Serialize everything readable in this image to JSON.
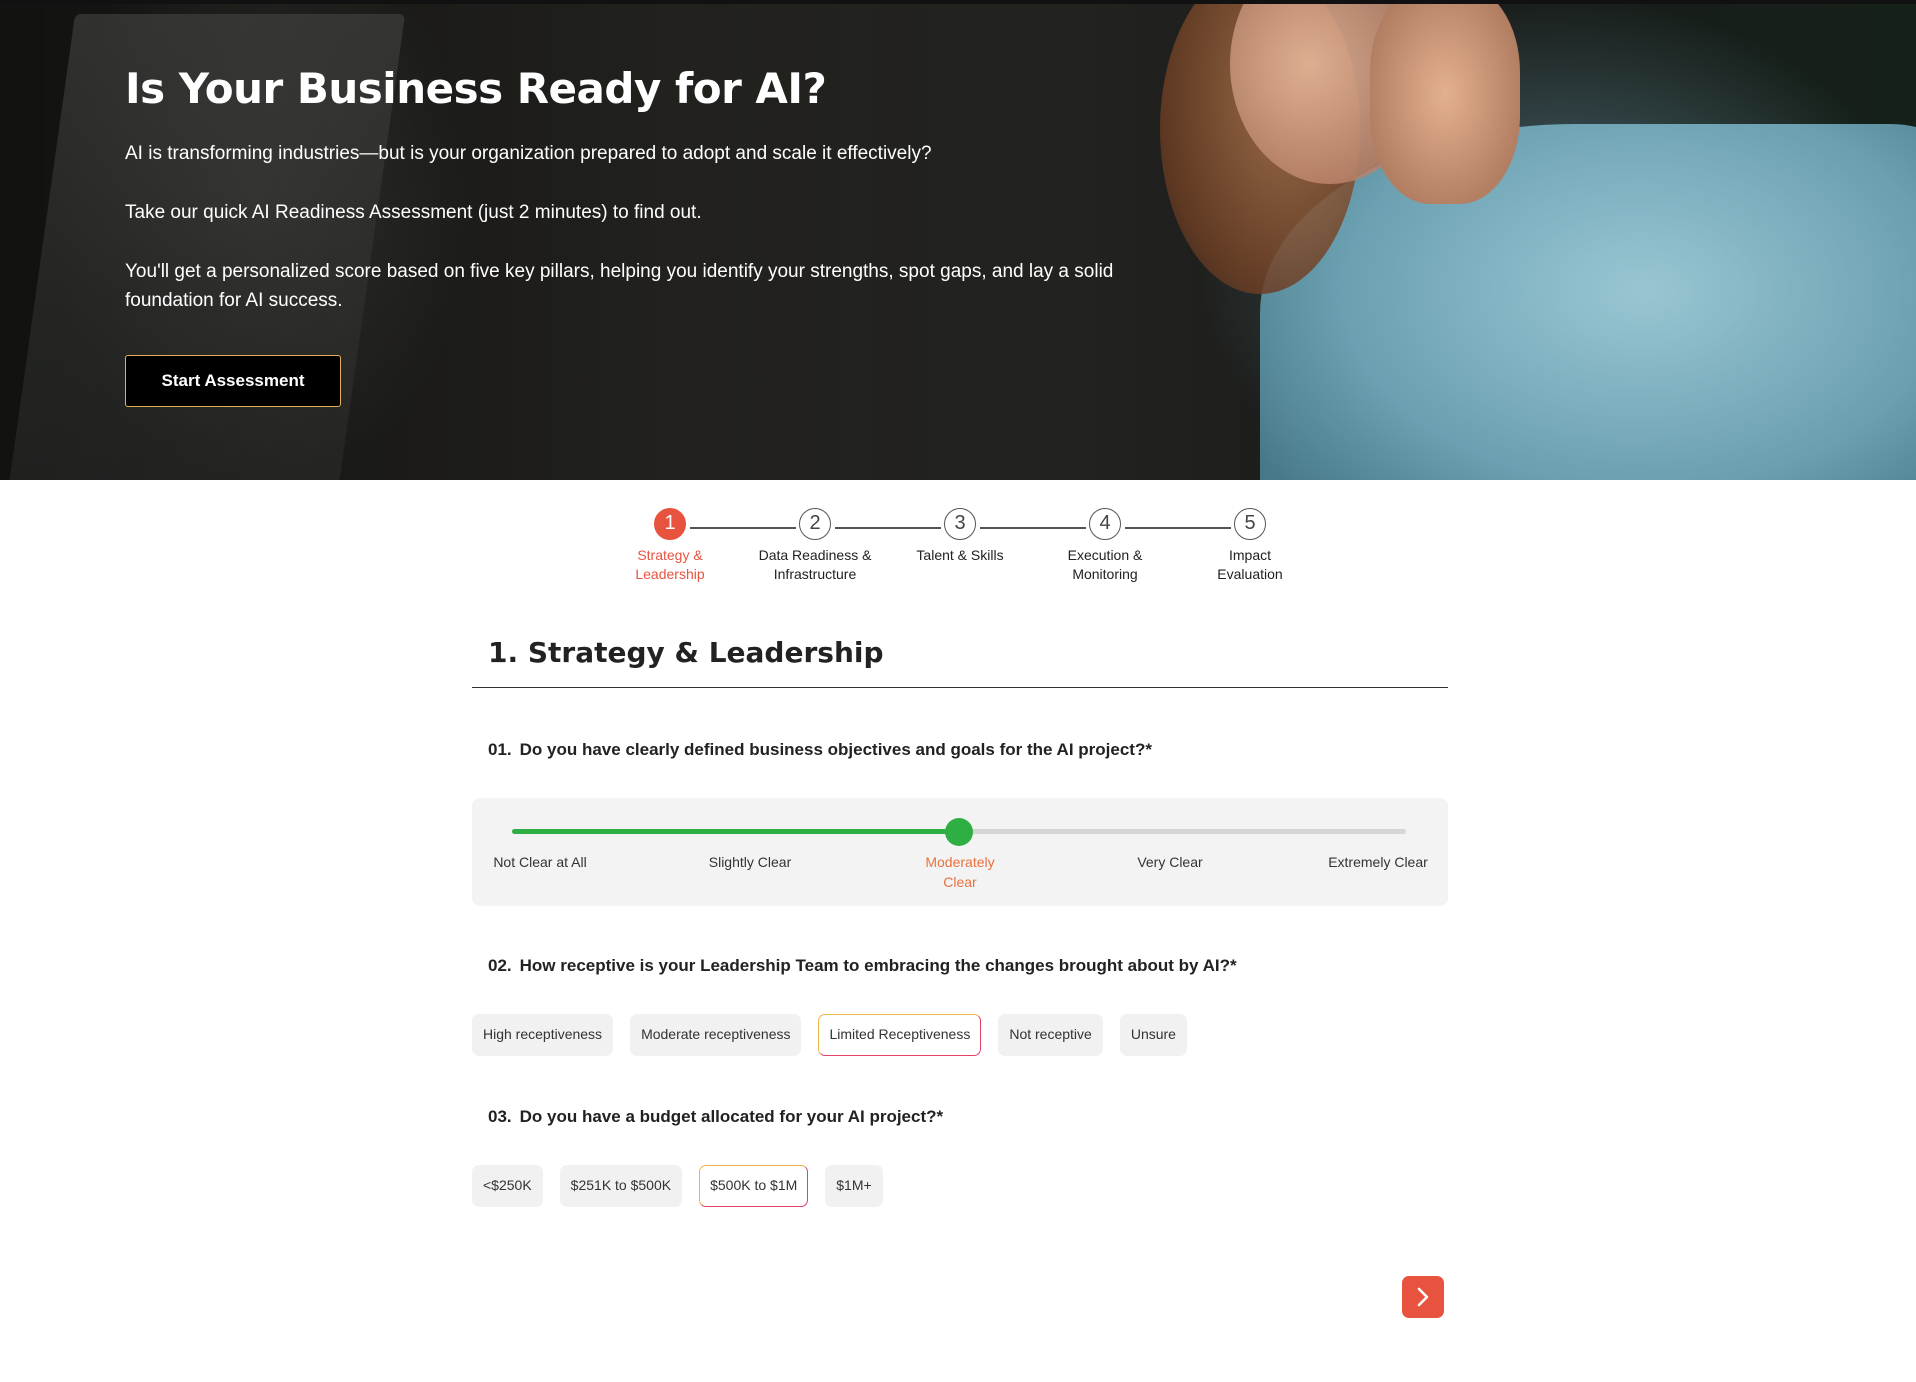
{
  "hero": {
    "title": "Is Your Business Ready for AI?",
    "p1": "AI is transforming industries—but is your organization prepared to adopt and scale it effectively?",
    "p2": "Take our quick AI Readiness Assessment (just 2 minutes) to find out.",
    "p3": "You'll get a personalized score based on five key pillars, helping you identify your strengths, spot gaps, and lay a solid foundation for AI success.",
    "start_label": "Start Assessment"
  },
  "stepper": {
    "steps": [
      {
        "num": "1",
        "label": "Strategy & Leadership",
        "active": true
      },
      {
        "num": "2",
        "label": "Data Readiness & Infrastructure",
        "active": false
      },
      {
        "num": "3",
        "label": "Talent & Skills",
        "active": false
      },
      {
        "num": "4",
        "label": "Execution & Monitoring",
        "active": false
      },
      {
        "num": "5",
        "label": "Impact Evaluation",
        "active": false
      }
    ]
  },
  "section": {
    "title": "1. Strategy & Leadership"
  },
  "q1": {
    "num": "01.",
    "text": "Do you have clearly defined business objectives and goals for the AI project?*",
    "scale": [
      "Not Clear at All",
      "Slightly Clear",
      "Moderately Clear",
      "Very Clear",
      "Extremely Clear"
    ],
    "selected_index": 2,
    "value_fraction": 0.5
  },
  "q2": {
    "num": "02.",
    "text": "How receptive is your Leadership Team to embracing the changes brought about by AI?*",
    "options": [
      "High receptiveness",
      "Moderate receptiveness",
      "Limited Receptiveness",
      "Not receptive",
      "Unsure"
    ],
    "selected_index": 2
  },
  "q3": {
    "num": "03.",
    "text": "Do you have a budget allocated for your AI project?*",
    "options": [
      "<$250K",
      "$251K to $500K",
      "$500K to $1M",
      "$1M+"
    ],
    "selected_index": 2
  },
  "colors": {
    "accent": "#e8533f",
    "slider": "#2fae44",
    "selected_label": "#e8713f"
  },
  "icons": {
    "next": "chevron-right-icon"
  }
}
